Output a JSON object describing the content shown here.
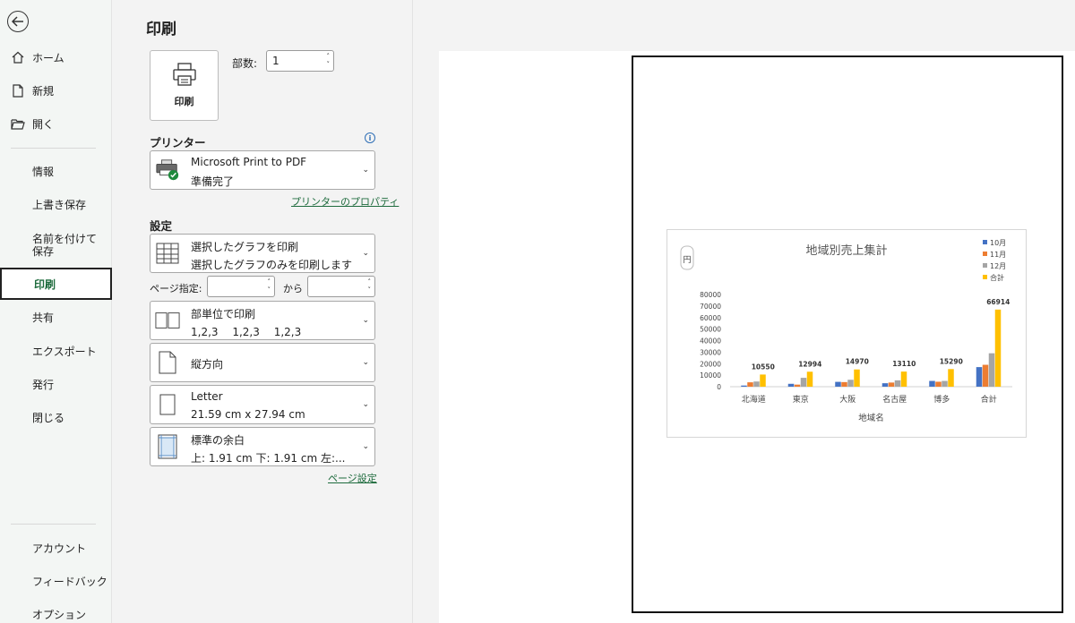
{
  "nav": {
    "top": [
      {
        "label": "ホーム",
        "icon": "home-icon"
      },
      {
        "label": "新規",
        "icon": "new-file-icon"
      },
      {
        "label": "開く",
        "icon": "open-folder-icon"
      }
    ],
    "items": [
      "情報",
      "上書き保存",
      "名前を付けて保存",
      "印刷",
      "共有",
      "エクスポート",
      "発行",
      "閉じる"
    ],
    "bottom": [
      "アカウント",
      "フィードバック",
      "オプション"
    ]
  },
  "panel": {
    "title": "印刷",
    "print_button": "印刷",
    "copies_label": "部数:",
    "copies_value": "1",
    "printer_section": "プリンター",
    "printer_name": "Microsoft Print to PDF",
    "printer_status": "準備完了",
    "printer_properties": "プリンターのプロパティ",
    "settings_section": "設定",
    "scope_line1": "選択したグラフを印刷",
    "scope_line2": "選択したグラフのみを印刷します",
    "pages_label": "ページ指定:",
    "pages_from": "",
    "pages_to_label": "から",
    "pages_to": "",
    "collate_line1": "部単位で印刷",
    "collate_line2": "1,2,3　 1,2,3　 1,2,3",
    "orientation": "縦方向",
    "paper_line1": "Letter",
    "paper_line2": "21.59 cm x 27.94 cm",
    "margins_line1": "標準の余白",
    "margins_line2": "上: 1.91 cm 下: 1.91 cm 左:...",
    "page_setup": "ページ設定"
  },
  "chart_data": {
    "type": "bar",
    "title": "地域別売上集計",
    "xlabel": "地域名",
    "ylabel": "円",
    "categories": [
      "北海道",
      "東京",
      "大阪",
      "名古屋",
      "博多",
      "合計"
    ],
    "ylim": [
      0,
      80000
    ],
    "yticks": [
      0,
      10000,
      20000,
      30000,
      40000,
      50000,
      60000,
      70000,
      80000
    ],
    "legend_position": "top-right",
    "series": [
      {
        "name": "10月",
        "color": "#4472c4",
        "values": [
          1000,
          2500,
          4200,
          3000,
          5000,
          17000
        ]
      },
      {
        "name": "11月",
        "color": "#ed7d31",
        "values": [
          3800,
          1800,
          4000,
          3600,
          4300,
          19000
        ]
      },
      {
        "name": "12月",
        "color": "#a5a5a5",
        "values": [
          4500,
          7700,
          6000,
          5500,
          5000,
          29000
        ]
      },
      {
        "name": "合計",
        "color": "#ffc000",
        "values": [
          10550,
          12994,
          14970,
          13110,
          15290,
          66914
        ]
      }
    ],
    "data_labels_series": "合計"
  }
}
